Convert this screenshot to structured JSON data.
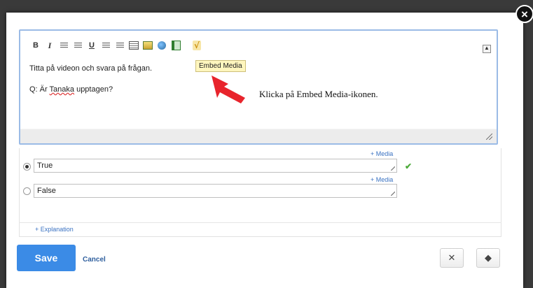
{
  "toolbar": {
    "icons": [
      "bold-icon",
      "italic-icon",
      "ordered-list-icon",
      "unordered-list-icon",
      "underline-icon",
      "align-left-icon",
      "align-right-icon",
      "table-icon",
      "image-icon",
      "globe-icon",
      "embed-media-icon",
      "equation-icon"
    ],
    "bold_label": "B",
    "italic_label": "I",
    "underline_label": "U",
    "equation_symbol": "√",
    "collapse_symbol": "▲"
  },
  "editor": {
    "line1": "Titta på videon och svara på frågan.",
    "line2_prefix": "Q: Är ",
    "line2_spell": "Tanaka",
    "line2_suffix": " upptagen?"
  },
  "tooltip": {
    "text": "Embed Media"
  },
  "annotation": {
    "text": "Klicka på Embed Media-ikonen."
  },
  "answers": [
    {
      "value": "True",
      "selected": true,
      "media_label": "+ Media",
      "correct": true
    },
    {
      "value": "False",
      "selected": false,
      "media_label": "+ Media",
      "correct": false
    }
  ],
  "explanation_label": "+ Explanation",
  "footer": {
    "save_label": "Save",
    "cancel_label": "Cancel"
  },
  "icon_names": {
    "close": "close-icon",
    "check": "checkmark-icon",
    "tools": "tools-icon",
    "tag": "tag-icon"
  },
  "colors": {
    "accent": "#3b8be6",
    "link": "#3a72c2",
    "check": "#4caa3a",
    "tooltip_bg": "#fff6be",
    "arrow": "#e8242c"
  }
}
